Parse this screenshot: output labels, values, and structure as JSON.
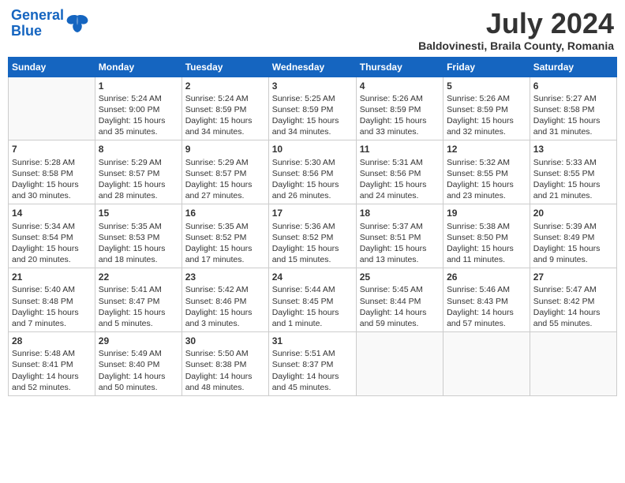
{
  "header": {
    "logo_line1": "General",
    "logo_line2": "Blue",
    "title": "July 2024",
    "subtitle": "Baldovinesti, Braila County, Romania"
  },
  "calendar": {
    "days_of_week": [
      "Sunday",
      "Monday",
      "Tuesday",
      "Wednesday",
      "Thursday",
      "Friday",
      "Saturday"
    ],
    "weeks": [
      [
        {
          "day": "",
          "info": ""
        },
        {
          "day": "1",
          "info": "Sunrise: 5:24 AM\nSunset: 9:00 PM\nDaylight: 15 hours\nand 35 minutes."
        },
        {
          "day": "2",
          "info": "Sunrise: 5:24 AM\nSunset: 8:59 PM\nDaylight: 15 hours\nand 34 minutes."
        },
        {
          "day": "3",
          "info": "Sunrise: 5:25 AM\nSunset: 8:59 PM\nDaylight: 15 hours\nand 34 minutes."
        },
        {
          "day": "4",
          "info": "Sunrise: 5:26 AM\nSunset: 8:59 PM\nDaylight: 15 hours\nand 33 minutes."
        },
        {
          "day": "5",
          "info": "Sunrise: 5:26 AM\nSunset: 8:59 PM\nDaylight: 15 hours\nand 32 minutes."
        },
        {
          "day": "6",
          "info": "Sunrise: 5:27 AM\nSunset: 8:58 PM\nDaylight: 15 hours\nand 31 minutes."
        }
      ],
      [
        {
          "day": "7",
          "info": "Sunrise: 5:28 AM\nSunset: 8:58 PM\nDaylight: 15 hours\nand 30 minutes."
        },
        {
          "day": "8",
          "info": "Sunrise: 5:29 AM\nSunset: 8:57 PM\nDaylight: 15 hours\nand 28 minutes."
        },
        {
          "day": "9",
          "info": "Sunrise: 5:29 AM\nSunset: 8:57 PM\nDaylight: 15 hours\nand 27 minutes."
        },
        {
          "day": "10",
          "info": "Sunrise: 5:30 AM\nSunset: 8:56 PM\nDaylight: 15 hours\nand 26 minutes."
        },
        {
          "day": "11",
          "info": "Sunrise: 5:31 AM\nSunset: 8:56 PM\nDaylight: 15 hours\nand 24 minutes."
        },
        {
          "day": "12",
          "info": "Sunrise: 5:32 AM\nSunset: 8:55 PM\nDaylight: 15 hours\nand 23 minutes."
        },
        {
          "day": "13",
          "info": "Sunrise: 5:33 AM\nSunset: 8:55 PM\nDaylight: 15 hours\nand 21 minutes."
        }
      ],
      [
        {
          "day": "14",
          "info": "Sunrise: 5:34 AM\nSunset: 8:54 PM\nDaylight: 15 hours\nand 20 minutes."
        },
        {
          "day": "15",
          "info": "Sunrise: 5:35 AM\nSunset: 8:53 PM\nDaylight: 15 hours\nand 18 minutes."
        },
        {
          "day": "16",
          "info": "Sunrise: 5:35 AM\nSunset: 8:52 PM\nDaylight: 15 hours\nand 17 minutes."
        },
        {
          "day": "17",
          "info": "Sunrise: 5:36 AM\nSunset: 8:52 PM\nDaylight: 15 hours\nand 15 minutes."
        },
        {
          "day": "18",
          "info": "Sunrise: 5:37 AM\nSunset: 8:51 PM\nDaylight: 15 hours\nand 13 minutes."
        },
        {
          "day": "19",
          "info": "Sunrise: 5:38 AM\nSunset: 8:50 PM\nDaylight: 15 hours\nand 11 minutes."
        },
        {
          "day": "20",
          "info": "Sunrise: 5:39 AM\nSunset: 8:49 PM\nDaylight: 15 hours\nand 9 minutes."
        }
      ],
      [
        {
          "day": "21",
          "info": "Sunrise: 5:40 AM\nSunset: 8:48 PM\nDaylight: 15 hours\nand 7 minutes."
        },
        {
          "day": "22",
          "info": "Sunrise: 5:41 AM\nSunset: 8:47 PM\nDaylight: 15 hours\nand 5 minutes."
        },
        {
          "day": "23",
          "info": "Sunrise: 5:42 AM\nSunset: 8:46 PM\nDaylight: 15 hours\nand 3 minutes."
        },
        {
          "day": "24",
          "info": "Sunrise: 5:44 AM\nSunset: 8:45 PM\nDaylight: 15 hours\nand 1 minute."
        },
        {
          "day": "25",
          "info": "Sunrise: 5:45 AM\nSunset: 8:44 PM\nDaylight: 14 hours\nand 59 minutes."
        },
        {
          "day": "26",
          "info": "Sunrise: 5:46 AM\nSunset: 8:43 PM\nDaylight: 14 hours\nand 57 minutes."
        },
        {
          "day": "27",
          "info": "Sunrise: 5:47 AM\nSunset: 8:42 PM\nDaylight: 14 hours\nand 55 minutes."
        }
      ],
      [
        {
          "day": "28",
          "info": "Sunrise: 5:48 AM\nSunset: 8:41 PM\nDaylight: 14 hours\nand 52 minutes."
        },
        {
          "day": "29",
          "info": "Sunrise: 5:49 AM\nSunset: 8:40 PM\nDaylight: 14 hours\nand 50 minutes."
        },
        {
          "day": "30",
          "info": "Sunrise: 5:50 AM\nSunset: 8:38 PM\nDaylight: 14 hours\nand 48 minutes."
        },
        {
          "day": "31",
          "info": "Sunrise: 5:51 AM\nSunset: 8:37 PM\nDaylight: 14 hours\nand 45 minutes."
        },
        {
          "day": "",
          "info": ""
        },
        {
          "day": "",
          "info": ""
        },
        {
          "day": "",
          "info": ""
        }
      ]
    ]
  }
}
